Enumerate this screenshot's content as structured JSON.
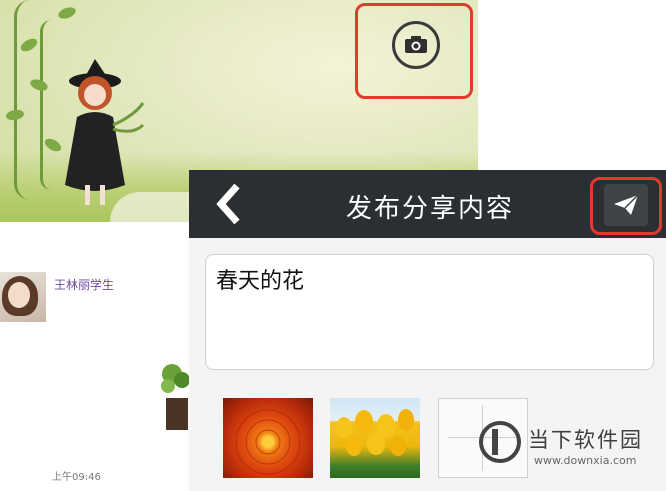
{
  "feed": {
    "username": "王林丽学生",
    "timestamp": "上午09:46"
  },
  "share_panel": {
    "title": "发布分享内容",
    "post_text": "春天的花"
  },
  "icons": {
    "camera": "camera-icon",
    "back": "chevron-left-icon",
    "send": "paper-plane-icon",
    "add_photo": "plus-icon"
  },
  "watermark": {
    "name": "当下软件园",
    "url": "www.downxia.com"
  },
  "colors": {
    "highlight": "#e23b2e",
    "topbar": "#2b2f33",
    "username": "#6e4a9e"
  }
}
